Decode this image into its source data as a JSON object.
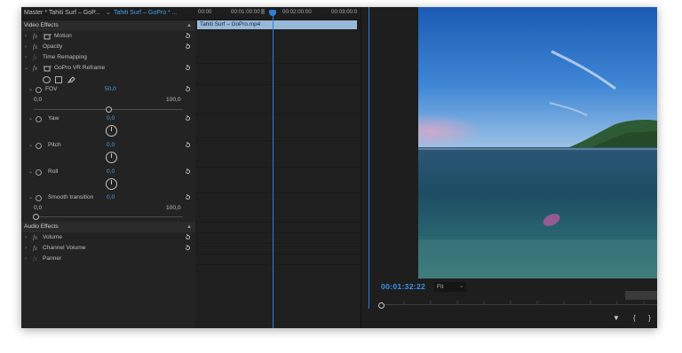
{
  "effect_controls": {
    "master_label": "Master * Tahiti Surf – GoP...",
    "clip_label": "Tahiti Surf – GoPro * ...",
    "video_section": "Video Effects",
    "effects": {
      "motion": "Motion",
      "opacity": "Opacity",
      "time_remapping": "Time Remapping",
      "reframe": "GoPro VR Reframe"
    },
    "fov": {
      "label": "FOV",
      "value": "50,0",
      "min": "0,0",
      "max": "100,0"
    },
    "yaw": {
      "label": "Yaw",
      "value": "0,0"
    },
    "pitch": {
      "label": "Pitch",
      "value": "0,0"
    },
    "roll": {
      "label": "Roll",
      "value": "0,0"
    },
    "smooth": {
      "label": "Smooth transition",
      "value": "0,0",
      "min": "0,0",
      "max": "100,0"
    },
    "audio_section": "Audio Effects",
    "audio": {
      "volume": "Volume",
      "channel_volume": "Channel Volume",
      "panner": "Panner"
    },
    "fx_glyph": "fx"
  },
  "mini_timeline": {
    "ticks": [
      "00:00",
      "00:01:00:00",
      "00:02:00:00",
      "00:03:00:0"
    ],
    "clip_name": "Tahiti Surf – GoPro.mp4"
  },
  "program_monitor": {
    "timecode": "00:01:32:22",
    "zoom": "Fit",
    "controls": [
      "add-marker-icon",
      "mark-in-icon",
      "mark-out-icon",
      "go-to-in-icon"
    ]
  },
  "colors": {
    "accent": "#2f7fd5",
    "value_blue": "#4a9fe8",
    "panel": "#232323",
    "clip": "#98b8d8"
  }
}
